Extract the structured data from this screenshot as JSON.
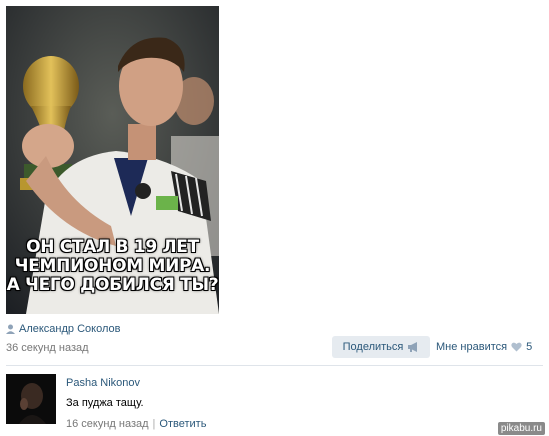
{
  "post": {
    "image_caption_lines": [
      "ОН СТАЛ В 19 ЛЕТ",
      "ЧЕМПИОНОМ МИРА.",
      "А ЧЕГО ДОБИЛСЯ ТЫ?"
    ],
    "author": "Александр Соколов",
    "time": "36 секунд назад",
    "share_label": "Поделиться",
    "like_label": "Мне нравится",
    "like_count": "5",
    "icons": {
      "author": "user-icon",
      "share": "megaphone-icon",
      "like": "heart-icon"
    }
  },
  "comment": {
    "author": "Pasha Nikonov",
    "text": "За пуджа тащу.",
    "time": "16 секунд назад",
    "separator": "|",
    "reply_label": "Ответить"
  },
  "watermark": "pikabu.ru",
  "colors": {
    "link": "#2b587a",
    "muted": "#777777",
    "share_bg": "#e6ebf0",
    "heart": "#b0bfcf"
  }
}
